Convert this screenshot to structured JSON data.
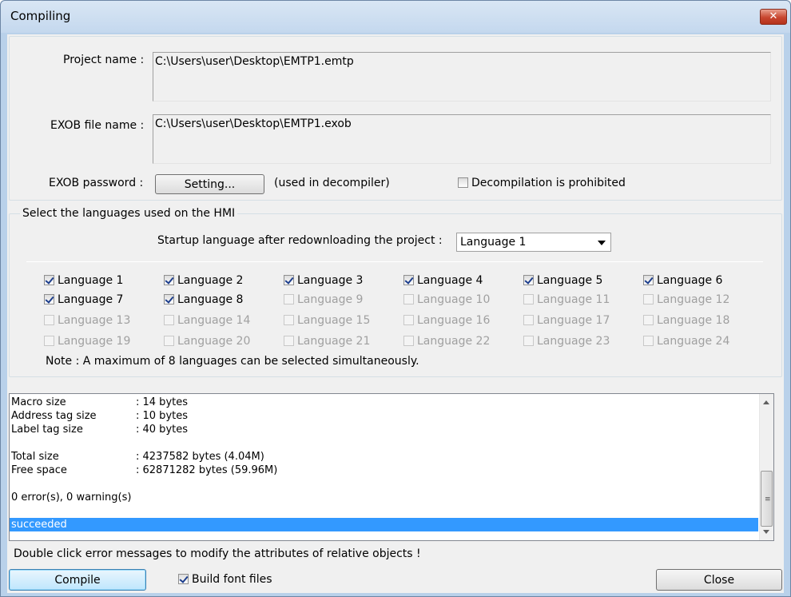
{
  "window": {
    "title": "Compiling",
    "close_glyph": "✕"
  },
  "project": {
    "project_name_label": "Project name :",
    "project_name_value": "C:\\Users\\user\\Desktop\\EMTP1.emtp",
    "exob_file_label": "EXOB file name :",
    "exob_file_value": "C:\\Users\\user\\Desktop\\EMTP1.exob",
    "exob_password_label": "EXOB password :",
    "setting_button": "Setting...",
    "used_in_decompiler": "(used in decompiler)",
    "decompilation_prohibited": "Decompilation is prohibited",
    "decompilation_prohibited_checked": false
  },
  "languages": {
    "group_title": "Select the languages used on the HMI",
    "startup_label": "Startup language after redownloading the project :",
    "startup_value": "Language 1",
    "items": [
      {
        "label": "Language 1",
        "checked": true,
        "enabled": true
      },
      {
        "label": "Language 2",
        "checked": true,
        "enabled": true
      },
      {
        "label": "Language 3",
        "checked": true,
        "enabled": true
      },
      {
        "label": "Language 4",
        "checked": true,
        "enabled": true
      },
      {
        "label": "Language 5",
        "checked": true,
        "enabled": true
      },
      {
        "label": "Language 6",
        "checked": true,
        "enabled": true
      },
      {
        "label": "Language 7",
        "checked": true,
        "enabled": true
      },
      {
        "label": "Language 8",
        "checked": true,
        "enabled": true
      },
      {
        "label": "Language 9",
        "checked": false,
        "enabled": false
      },
      {
        "label": "Language 10",
        "checked": false,
        "enabled": false
      },
      {
        "label": "Language 11",
        "checked": false,
        "enabled": false
      },
      {
        "label": "Language 12",
        "checked": false,
        "enabled": false
      },
      {
        "label": "Language 13",
        "checked": false,
        "enabled": false
      },
      {
        "label": "Language 14",
        "checked": false,
        "enabled": false
      },
      {
        "label": "Language 15",
        "checked": false,
        "enabled": false
      },
      {
        "label": "Language 16",
        "checked": false,
        "enabled": false
      },
      {
        "label": "Language 17",
        "checked": false,
        "enabled": false
      },
      {
        "label": "Language 18",
        "checked": false,
        "enabled": false
      },
      {
        "label": "Language 19",
        "checked": false,
        "enabled": false
      },
      {
        "label": "Language 20",
        "checked": false,
        "enabled": false
      },
      {
        "label": "Language 21",
        "checked": false,
        "enabled": false
      },
      {
        "label": "Language 22",
        "checked": false,
        "enabled": false
      },
      {
        "label": "Language 23",
        "checked": false,
        "enabled": false
      },
      {
        "label": "Language 24",
        "checked": false,
        "enabled": false
      }
    ],
    "note": "Note : A maximum of 8 languages can be selected simultaneously."
  },
  "log": {
    "lines": [
      {
        "key": "Macro size",
        "value": ":  14 bytes"
      },
      {
        "key": "Address tag size",
        "value": ":  10 bytes"
      },
      {
        "key": "Label tag size",
        "value": ":  40 bytes"
      },
      {
        "key": "",
        "value": ""
      },
      {
        "key": "Total size",
        "value": ":  4237582 bytes (4.04M)"
      },
      {
        "key": "Free space",
        "value": ":  62871282 bytes (59.96M)"
      },
      {
        "key": "",
        "value": ""
      },
      {
        "key": "0 error(s), 0 warning(s)",
        "value": ""
      },
      {
        "key": "",
        "value": ""
      },
      {
        "key": "succeeded",
        "value": "",
        "selected": true
      }
    ]
  },
  "footer": {
    "hint": "Double click error messages to modify the attributes of relative objects !",
    "compile_button": "Compile",
    "build_font_files": "Build font files",
    "build_font_files_checked": true,
    "close_button": "Close"
  }
}
